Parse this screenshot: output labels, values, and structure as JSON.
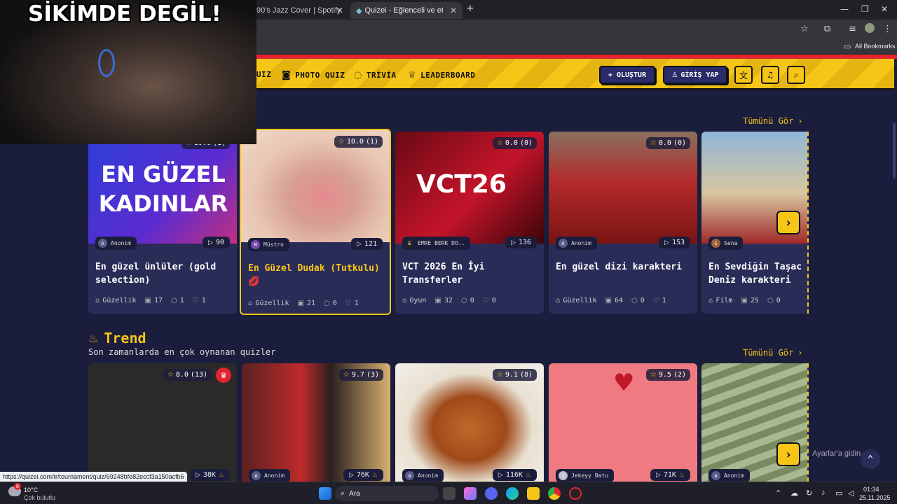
{
  "overlay_text": "SİKİMDE DEGİL!",
  "tabs": [
    {
      "label": "90's Jazz Cover | Spotify"
    },
    {
      "label": "Quizei - Eğlenceli ve etkileşimli"
    }
  ],
  "bookmarks": {
    "all": "All Bookmarks"
  },
  "nav": {
    "quiz": "UIZ",
    "photo_quiz": "PHOTO QUIZ",
    "trivia": "TRİVİA",
    "leaderboard": "LEADERBOARD",
    "create": "+ OLUŞTUR",
    "login": "GİRİŞ YAP"
  },
  "section1": {
    "see_all": "Tümünü Gör"
  },
  "cards1": [
    {
      "thumb_text": "EN GÜZEL KADINLAR",
      "rating": "10.0",
      "count": "(1)",
      "author": "Anonim",
      "avatar": "A",
      "plays": "90",
      "title": "En güzel ünlüler (gold selection)",
      "category": "Güzellik",
      "questions": "17",
      "comments": "1",
      "likes": "1"
    },
    {
      "rating": "10.0",
      "count": "(1)",
      "author": "Müstro",
      "avatar": "M",
      "plays": "121",
      "title": "En Güzel Dudak (Tutkulu)💋",
      "category": "Güzellik",
      "questions": "21",
      "comments": "0",
      "likes": "1"
    },
    {
      "thumb_text": "VCT26",
      "rating": "0.0",
      "count": "(0)",
      "author": "EMRE BERK DO..",
      "avatar": "E",
      "plays": "136",
      "title": "VCT 2026 En İyi Transferler",
      "category": "Oyun",
      "questions": "32",
      "comments": "0",
      "likes": "0"
    },
    {
      "rating": "0.0",
      "count": "(0)",
      "author": "Anonim",
      "avatar": "A",
      "plays": "153",
      "title": "En güzel dizi karakteri",
      "category": "Güzellik",
      "questions": "64",
      "comments": "0",
      "likes": "1"
    },
    {
      "author": "Sena",
      "avatar": "S",
      "title": "En Sevdiğin Taşac Deniz karakteri",
      "category": "Film",
      "questions": "25",
      "comments": "0"
    }
  ],
  "section2": {
    "title": "Trend",
    "subtitle": "Son zamanlarda en çok oynanan quizler",
    "see_all": "Tümünü Gör"
  },
  "cards2": [
    {
      "rating": "8.0",
      "count": "(13)",
      "plays": "38K"
    },
    {
      "rating": "9.7",
      "count": "(3)",
      "author": "Anonim",
      "avatar": "A",
      "plays": "76K"
    },
    {
      "rating": "9.1",
      "count": "(8)",
      "author": "Anonim",
      "avatar": "A",
      "plays": "116K"
    },
    {
      "rating": "9.5",
      "count": "(2)",
      "author": "Jekeyy Batu",
      "avatar": "J",
      "plays": "71K"
    },
    {
      "author": "Anonim",
      "avatar": "A"
    }
  ],
  "status_url": "https://quizei.com/tr/tournament/quiz/69248bfe82eccf3a150acfb6",
  "activate_hint": "Ayarlar'a gidin.",
  "taskbar": {
    "temp": "10°C",
    "weather": "Çok bulutlu",
    "search": "Ara",
    "time": "01:34",
    "date": "25.11.2025",
    "badge": "8"
  }
}
